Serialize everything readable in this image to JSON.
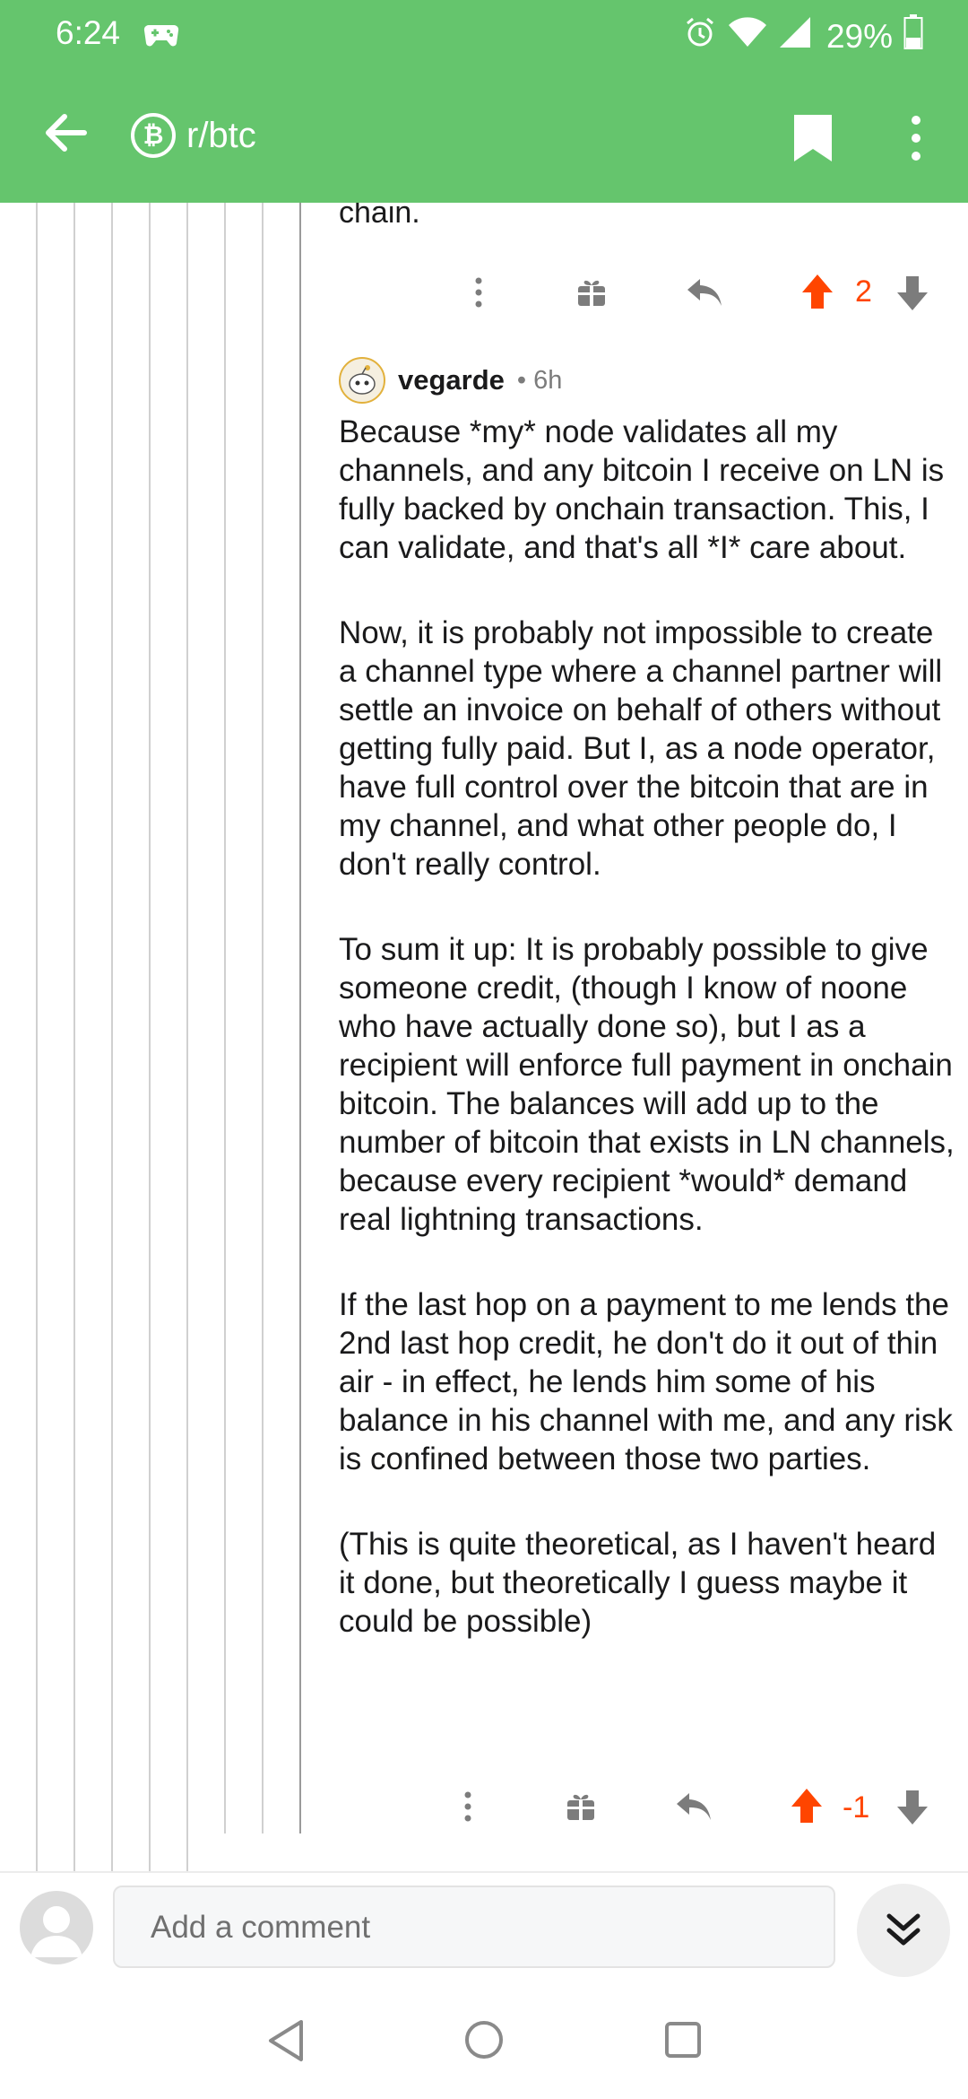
{
  "status": {
    "time": "6:24",
    "battery": "29%"
  },
  "header": {
    "subreddit": "r/btc",
    "sub_icon_glyph": "₿"
  },
  "prev_comment": {
    "tail_text": "chain.",
    "score": "2"
  },
  "comment": {
    "author": "vegarde",
    "meta": "• 6h",
    "paragraphs": [
      "Because *my* node validates all my channels, and any bitcoin I receive on LN is fully backed by onchain transaction. This, I can validate, and that's all *I* care about.",
      "Now, it is probably not impossible to create a channel type where a channel partner will settle an invoice on behalf of others without getting fully paid. But I, as a node operator, have full control over the bitcoin that are in my channel, and what other people do, I don't really control.",
      "To sum it up: It is probably possible to give someone credit, (though I know of noone who have actually done so), but I as a recipient will enforce full payment in onchain bitcoin. The balances will add up to the number of bitcoin that exists in LN channels, because every recipient  *would* demand real lightning transactions.",
      "If the last hop on a payment to me lends the 2nd last hop credit, he don't do it out of thin air - in effect, he lends him some of his balance in his channel with me, and any risk is confined between those two parties.",
      "(This is quite theoretical, as I haven't heard it done, but theoretically I guess maybe it could be possible)"
    ],
    "score": "-1"
  },
  "composer": {
    "placeholder": "Add a comment"
  },
  "colors": {
    "brand": "#65c56d",
    "upvote": "#ff4500"
  }
}
